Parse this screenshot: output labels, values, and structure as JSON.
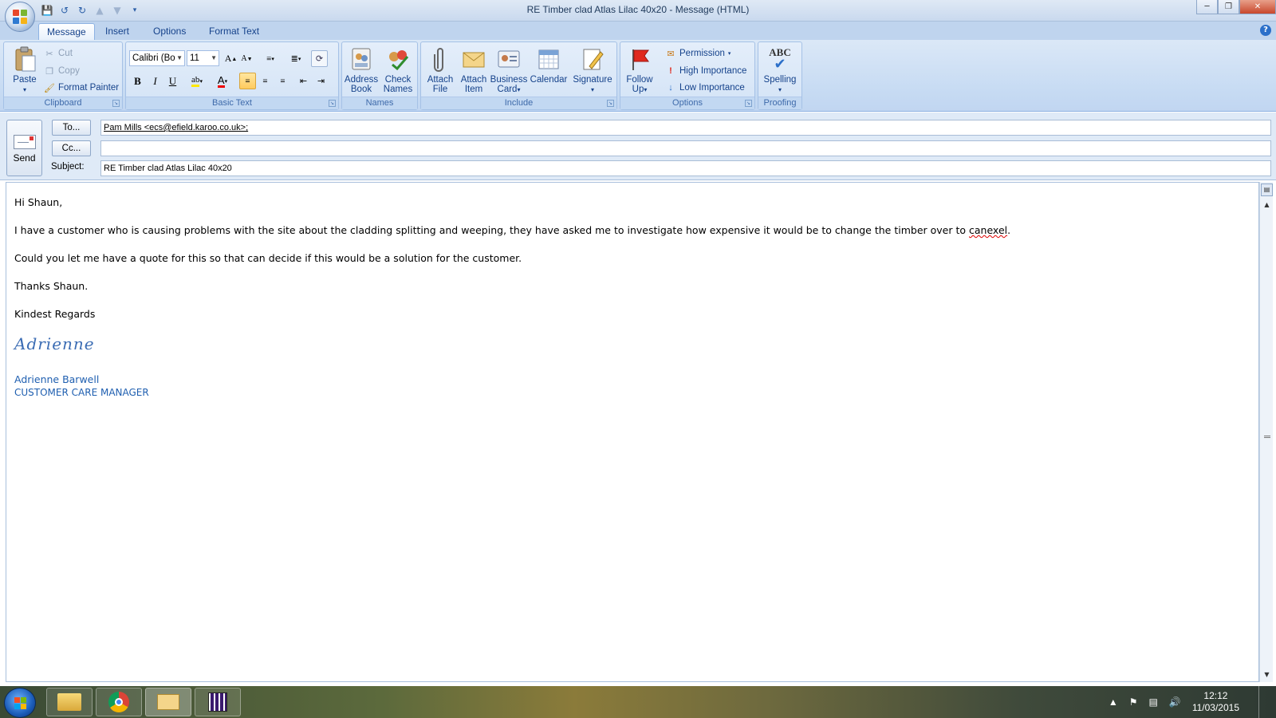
{
  "window": {
    "title": "RE Timber clad Atlas Lilac 40x20 - Message (HTML)"
  },
  "tabs": [
    "Message",
    "Insert",
    "Options",
    "Format Text"
  ],
  "ribbon": {
    "clipboard": {
      "paste": "Paste",
      "cut": "Cut",
      "copy": "Copy",
      "format_painter": "Format Painter",
      "label": "Clipboard"
    },
    "basic_text": {
      "font": "Calibri (Bo",
      "size": "11",
      "bold": "B",
      "italic": "I",
      "underline": "U",
      "label": "Basic Text"
    },
    "names": {
      "address_book": [
        "Address",
        "Book"
      ],
      "check_names": [
        "Check",
        "Names"
      ],
      "label": "Names"
    },
    "include": {
      "attach_file": [
        "Attach",
        "File"
      ],
      "attach_item": [
        "Attach",
        "Item"
      ],
      "business_card": [
        "Business",
        "Card"
      ],
      "calendar": "Calendar",
      "signature": "Signature",
      "label": "Include"
    },
    "options": {
      "follow_up": [
        "Follow",
        "Up"
      ],
      "permission": "Permission",
      "high_importance": "High Importance",
      "low_importance": "Low Importance",
      "label": "Options"
    },
    "proofing": {
      "spelling": "Spelling",
      "abc": "ABC",
      "label": "Proofing"
    }
  },
  "header": {
    "send": "Send",
    "to_button": "To...",
    "cc_button": "Cc...",
    "subject_label": "Subject:",
    "to_value": "Pam Mills <ecs@efield.karoo.co.uk>;",
    "cc_value": "",
    "subject_value": "RE Timber clad Atlas Lilac 40x20"
  },
  "body": {
    "greeting": "Hi Shaun,",
    "para1_before": "I have a customer who is causing problems with the site about the cladding splitting and weeping, they have asked me to investigate how expensive it would be to change the timber over to ",
    "para1_misspelled": "canexel",
    "para1_after": ".",
    "para2": "Could you let me have a quote for this so that can decide if this would be a solution for the customer.",
    "para3": "Thanks Shaun.",
    "closing": "Kindest Regards",
    "signature_script": "Adrienne",
    "sig_name": "Adrienne Barwell",
    "sig_title": "CUSTOMER CARE MANAGER"
  },
  "taskbar": {
    "time": "12:12",
    "date": "11/03/2015"
  },
  "colors": {
    "ribbon_text": "#15428b",
    "signature_blue": "#1f5fb0",
    "spell_error": "#dd0000"
  }
}
